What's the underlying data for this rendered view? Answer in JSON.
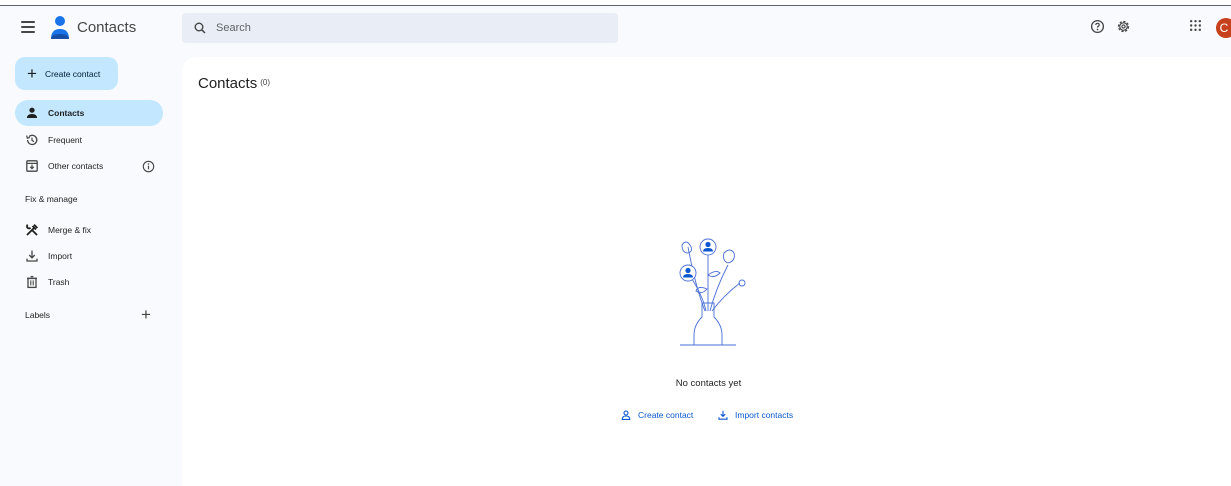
{
  "app": {
    "name": "Contacts"
  },
  "search": {
    "placeholder": "Search"
  },
  "header": {
    "avatar_letter": "C"
  },
  "sidebar": {
    "create_label": "Create contact",
    "items": [
      {
        "label": "Contacts",
        "icon": "person-icon",
        "active": true
      },
      {
        "label": "Frequent",
        "icon": "history-icon"
      },
      {
        "label": "Other contacts",
        "icon": "inbox-download-icon"
      }
    ],
    "fix_manage_label": "Fix & manage",
    "manage_items": [
      {
        "label": "Merge & fix",
        "icon": "merge-tools-icon"
      },
      {
        "label": "Import",
        "icon": "download-icon"
      },
      {
        "label": "Trash",
        "icon": "trash-icon"
      }
    ],
    "labels_label": "Labels"
  },
  "main": {
    "title": "Contacts",
    "count": "(0)",
    "empty_text": "No contacts yet",
    "create_action": "Create contact",
    "import_action": "Import contacts"
  },
  "colors": {
    "accent": "#0b57d0",
    "active_bg": "#c2e7ff",
    "avatar_bg": "#c5401b",
    "search_bg": "#e9eef6",
    "page_bg": "#f8fafd"
  }
}
